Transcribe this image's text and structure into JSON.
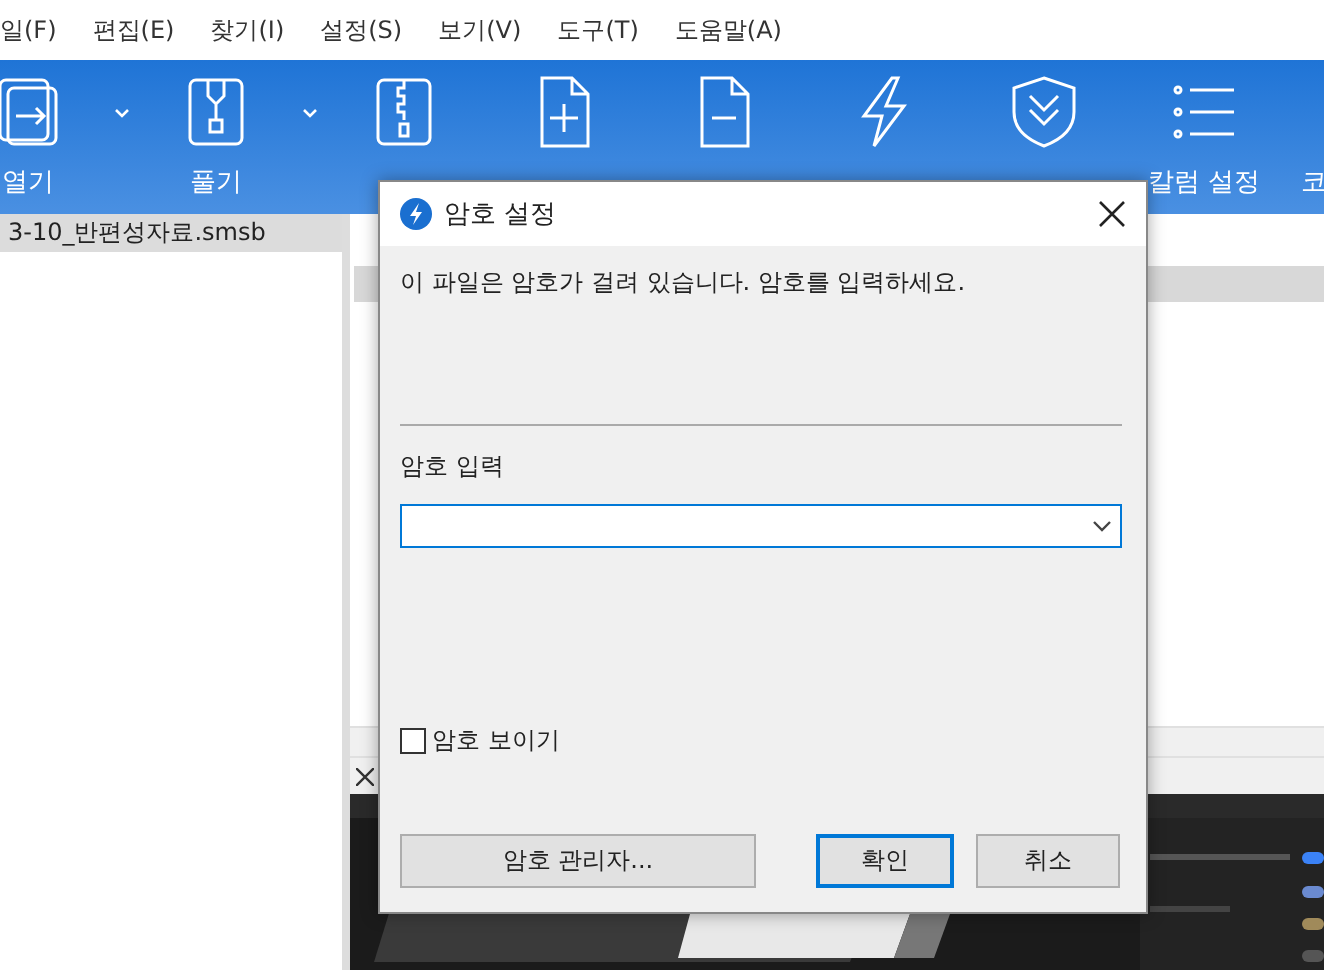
{
  "menu": [
    "일(F)",
    "편집(E)",
    "찾기(I)",
    "설정(S)",
    "보기(V)",
    "도구(T)",
    "도움말(A)"
  ],
  "toolbar": [
    {
      "label": "열기",
      "kind": "open",
      "dropdown": true
    },
    {
      "label": "풀기",
      "kind": "extract",
      "dropdown": true
    },
    {
      "kind": "compress",
      "dropdown": false
    },
    {
      "kind": "add",
      "dropdown": false
    },
    {
      "kind": "delete",
      "dropdown": false
    },
    {
      "kind": "test",
      "dropdown": false
    },
    {
      "kind": "scan",
      "dropdown": false
    },
    {
      "label": "칼럼 설정",
      "kind": "columns",
      "dropdown": false
    },
    {
      "label": "코",
      "kind": "text",
      "dropdown": false
    }
  ],
  "file_list": [
    {
      "name": "3-10_반편성자료.smsb",
      "selected": true
    }
  ],
  "dialog": {
    "title": "암호 설정",
    "message": "이 파일은 암호가 걸려 있습니다. 암호를 입력하세요.",
    "password_label": "암호 입력",
    "show_password": {
      "label": "암호 보이기",
      "checked": false
    },
    "buttons": [
      {
        "label": "암호 관리자...",
        "default": false
      },
      {
        "label": "확인",
        "default": true
      },
      {
        "label": "취소",
        "default": false
      }
    ]
  }
}
